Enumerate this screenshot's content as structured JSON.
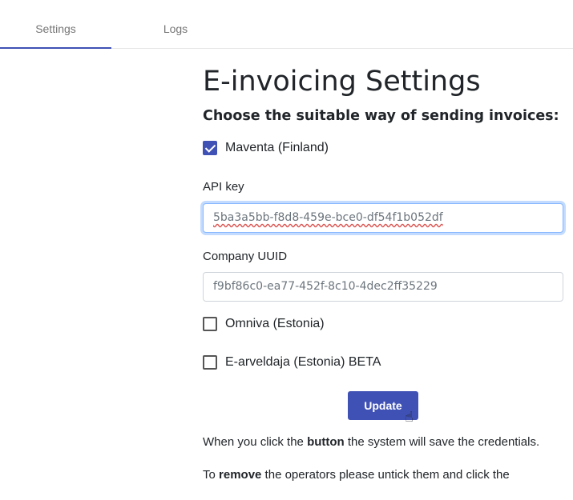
{
  "tabs": [
    {
      "label": "Settings"
    },
    {
      "label": "Logs"
    }
  ],
  "page": {
    "title": "E-invoicing Settings",
    "subtitle": "Choose the suitable way of sending invoices:"
  },
  "operators": [
    {
      "label": "Maventa (Finland)",
      "checked": true
    },
    {
      "label": "Omniva (Estonia)",
      "checked": false
    },
    {
      "label": "E-arveldaja (Estonia) BETA",
      "checked": false
    }
  ],
  "fields": {
    "api_key": {
      "label": "API key",
      "value": "5ba3a5bb-f8d8-459e-bce0-df54f1b052df"
    },
    "company_uuid": {
      "label": "Company UUID",
      "value": "f9bf86c0-ea77-452f-8c10-4dec2ff35229"
    }
  },
  "update_button": {
    "label": "Update"
  },
  "help": {
    "p1_before": "When you click the ",
    "p1_bold": "button",
    "p1_after": " the system will save the credentials.",
    "p2_before": "To ",
    "p2_bold": "remove",
    "p2_after": " the operators please untick them and click the"
  },
  "colors": {
    "accent": "#3f51b5"
  }
}
